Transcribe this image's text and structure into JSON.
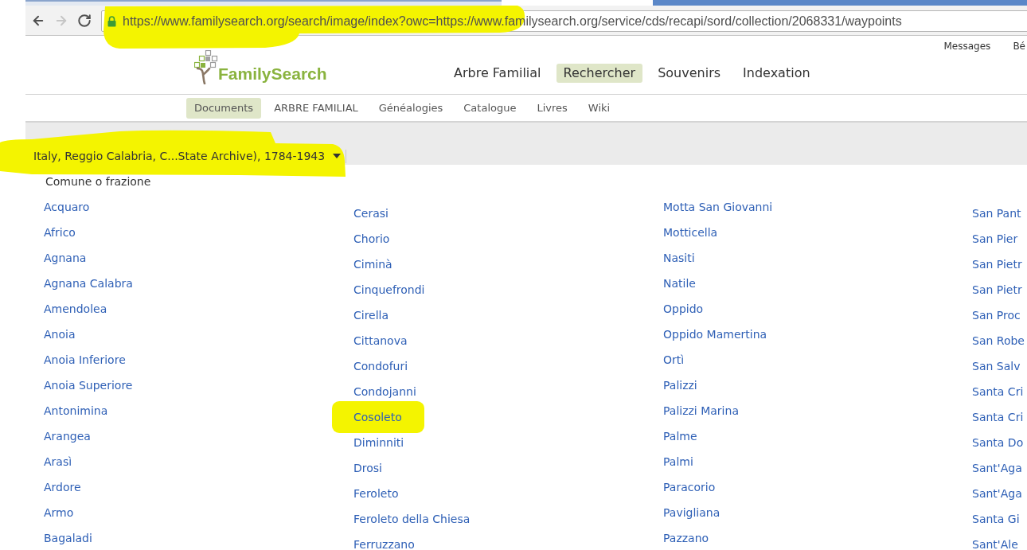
{
  "browser": {
    "nav_buttons": [
      {
        "kind": "back",
        "disabled": false
      },
      {
        "kind": "forward",
        "disabled": true
      },
      {
        "kind": "reload",
        "disabled": false
      }
    ],
    "address_bar": {
      "url": "https://www.familysearch.org/search/image/index?owc=https://www.familysearch.org/service/cds/recapi/sord/collection/2068331/waypoints",
      "secure": true,
      "highlighted": true
    }
  },
  "header": {
    "user_links": [
      "Messages",
      "Bé"
    ],
    "logo": {
      "text": "FamilySearch"
    },
    "nav": [
      {
        "label": "Arbre Familial",
        "selected": false
      },
      {
        "label": "Rechercher",
        "selected": true
      },
      {
        "label": "Souvenirs",
        "selected": false
      },
      {
        "label": "Indexation",
        "selected": false
      }
    ]
  },
  "subnav": [
    {
      "label": "Documents",
      "selected": true
    },
    {
      "label": "ARBRE FAMILIAL",
      "selected": false
    },
    {
      "label": "Généalogies",
      "selected": false
    },
    {
      "label": "Catalogue",
      "selected": false
    },
    {
      "label": "Livres",
      "selected": false
    },
    {
      "label": "Wiki",
      "selected": false
    }
  ],
  "collection": {
    "title": "Italy, Reggio Calabria, C...State Archive), 1784-1943",
    "highlighted": true
  },
  "list_heading": "Comune o frazione",
  "columns": [
    {
      "items": [
        {
          "label": "Acquaro",
          "highlighted": false
        },
        {
          "label": "Africo",
          "highlighted": false
        },
        {
          "label": "Agnana",
          "highlighted": false
        },
        {
          "label": "Agnana Calabra",
          "highlighted": false
        },
        {
          "label": "Amendolea",
          "highlighted": false
        },
        {
          "label": "Anoia",
          "highlighted": false
        },
        {
          "label": "Anoia Inferiore",
          "highlighted": false
        },
        {
          "label": "Anoia Superiore",
          "highlighted": false
        },
        {
          "label": "Antonimina",
          "highlighted": false
        },
        {
          "label": "Arangea",
          "highlighted": false
        },
        {
          "label": "Arasì",
          "highlighted": false
        },
        {
          "label": "Ardore",
          "highlighted": false
        },
        {
          "label": "Armo",
          "highlighted": false
        },
        {
          "label": "Bagaladi",
          "highlighted": false
        }
      ]
    },
    {
      "items": [
        {
          "label": "Cerasi",
          "highlighted": false
        },
        {
          "label": "Chorio",
          "highlighted": false
        },
        {
          "label": "Ciminà",
          "highlighted": false
        },
        {
          "label": "Cinquefrondi",
          "highlighted": false
        },
        {
          "label": "Cirella",
          "highlighted": false
        },
        {
          "label": "Cittanova",
          "highlighted": false
        },
        {
          "label": "Condofuri",
          "highlighted": false
        },
        {
          "label": "Condojanni",
          "highlighted": false
        },
        {
          "label": "Cosoleto",
          "highlighted": true
        },
        {
          "label": "Diminniti",
          "highlighted": false
        },
        {
          "label": "Drosi",
          "highlighted": false
        },
        {
          "label": "Feroleto",
          "highlighted": false
        },
        {
          "label": "Feroleto della Chiesa",
          "highlighted": false
        },
        {
          "label": "Ferruzzano",
          "highlighted": false
        }
      ]
    },
    {
      "items": [
        {
          "label": "Motta San Giovanni",
          "highlighted": false
        },
        {
          "label": "Motticella",
          "highlighted": false
        },
        {
          "label": "Nasiti",
          "highlighted": false
        },
        {
          "label": "Natile",
          "highlighted": false
        },
        {
          "label": "Oppido",
          "highlighted": false
        },
        {
          "label": "Oppido Mamertina",
          "highlighted": false
        },
        {
          "label": "Ortì",
          "highlighted": false
        },
        {
          "label": "Palizzi",
          "highlighted": false
        },
        {
          "label": "Palizzi Marina",
          "highlighted": false
        },
        {
          "label": "Palme",
          "highlighted": false
        },
        {
          "label": "Palmi",
          "highlighted": false
        },
        {
          "label": "Paracorio",
          "highlighted": false
        },
        {
          "label": "Pavigliana",
          "highlighted": false
        },
        {
          "label": "Pazzano",
          "highlighted": false
        }
      ]
    },
    {
      "items": [
        {
          "label": "San Pant",
          "highlighted": false
        },
        {
          "label": "San Pier",
          "highlighted": false
        },
        {
          "label": "San Pietr",
          "highlighted": false
        },
        {
          "label": "San Pietr",
          "highlighted": false
        },
        {
          "label": "San Proc",
          "highlighted": false
        },
        {
          "label": "San Robe",
          "highlighted": false
        },
        {
          "label": "San Salv",
          "highlighted": false
        },
        {
          "label": "Santa Cri",
          "highlighted": false
        },
        {
          "label": "Santa Cri",
          "highlighted": false
        },
        {
          "label": "Santa Do",
          "highlighted": false
        },
        {
          "label": "Sant'Aga",
          "highlighted": false
        },
        {
          "label": "Sant'Aga",
          "highlighted": false
        },
        {
          "label": "Santa Gi",
          "highlighted": false
        },
        {
          "label": "Sant'Ale",
          "highlighted": false
        }
      ]
    }
  ]
}
